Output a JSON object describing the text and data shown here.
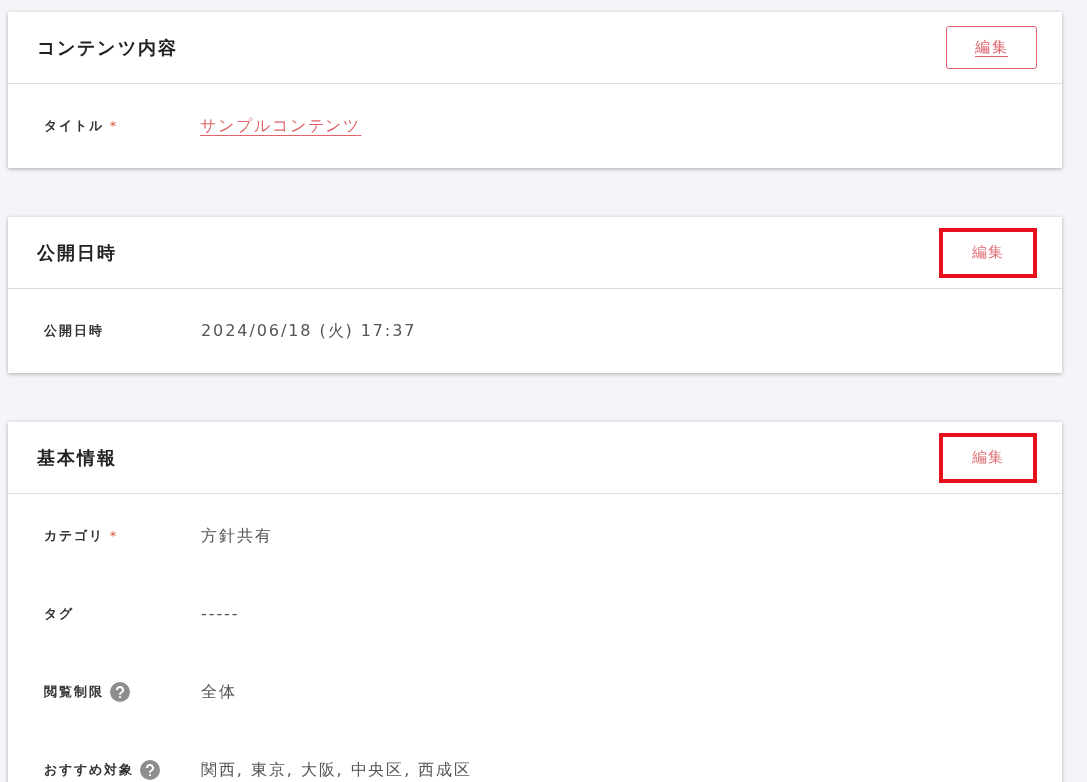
{
  "cards": [
    {
      "title": "コンテンツ内容",
      "edit_button": {
        "label": "編集",
        "kind": "outline"
      },
      "fields": [
        {
          "label": "タイトル",
          "required_mark": "*",
          "help": false,
          "value": "サンプルコンテンツ",
          "kind": "link"
        }
      ]
    },
    {
      "title": "公開日時",
      "edit_button": {
        "label": "編集",
        "kind": "highlight"
      },
      "fields": [
        {
          "label": "公開日時",
          "help": false,
          "value": "2024/06/18 (火) 17:37",
          "kind": "text"
        }
      ]
    },
    {
      "title": "基本情報",
      "edit_button": {
        "label": "編集",
        "kind": "highlight"
      },
      "fields": [
        {
          "label": "カテゴリ",
          "required_mark": "*",
          "help": false,
          "value": "方針共有",
          "kind": "text"
        },
        {
          "label": "タグ",
          "help": false,
          "value": "-----",
          "kind": "text"
        },
        {
          "label": "閲覧制限",
          "help": true,
          "value": "全体",
          "kind": "text"
        },
        {
          "label": "おすすめ対象",
          "help": true,
          "value": "関西, 東京, 大阪, 中央区, 西成区",
          "kind": "text"
        }
      ]
    }
  ]
}
